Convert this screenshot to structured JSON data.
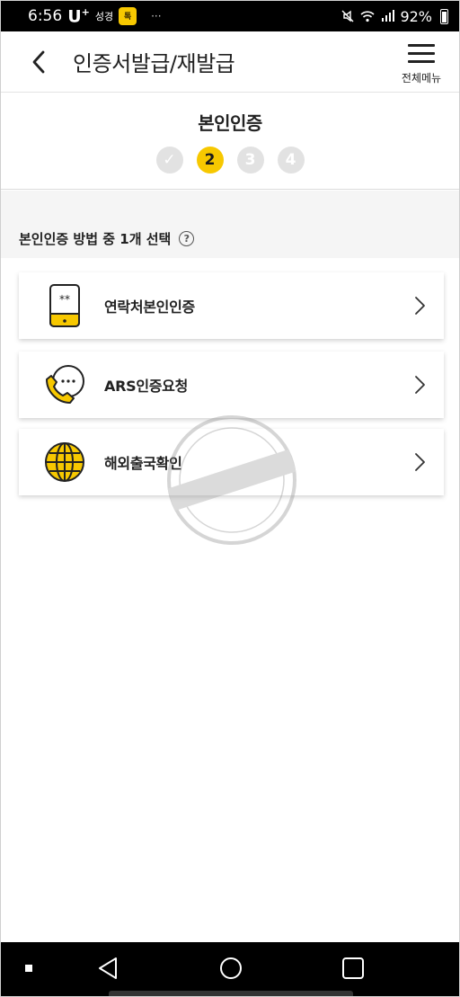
{
  "status_bar": {
    "time": "6:56",
    "carrier": "U",
    "carrier_plus": "+",
    "carrier_sub": "성경",
    "badge_text": "톡",
    "dots": "···",
    "battery_percent": "92%"
  },
  "header": {
    "title": "인증서발급/재발급",
    "menu_label": "전체메뉴"
  },
  "steps": {
    "title": "본인인증",
    "items": [
      {
        "label": "✓",
        "state": "done"
      },
      {
        "label": "2",
        "state": "active"
      },
      {
        "label": "3",
        "state": "pending"
      },
      {
        "label": "4",
        "state": "pending"
      }
    ]
  },
  "section": {
    "label": "본인인증 방법 중 1개 선택",
    "help_glyph": "?"
  },
  "options": [
    {
      "label": "연락처본인인증",
      "icon": "phone-verify-icon"
    },
    {
      "label": "ARS인증요청",
      "icon": "ars-call-icon"
    },
    {
      "label": "해외출국확인",
      "icon": "globe-icon"
    }
  ],
  "colors": {
    "accent": "#f7c800",
    "step_inactive": "#e2e2e2",
    "background_gray": "#f5f5f5"
  }
}
